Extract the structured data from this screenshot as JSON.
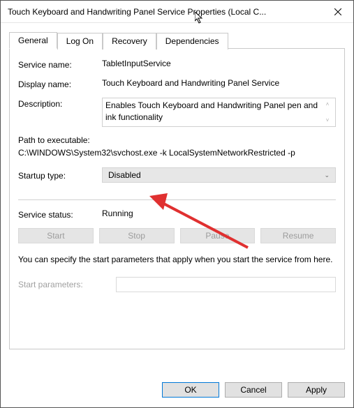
{
  "window": {
    "title": "Touch Keyboard and Handwriting Panel Service Properties (Local C..."
  },
  "tabs": {
    "general": "General",
    "log_on": "Log On",
    "recovery": "Recovery",
    "dependencies": "Dependencies"
  },
  "general": {
    "service_name_label": "Service name:",
    "service_name_value": "TabletInputService",
    "display_name_label": "Display name:",
    "display_name_value": "Touch Keyboard and Handwriting Panel Service",
    "description_label": "Description:",
    "description_value": "Enables Touch Keyboard and Handwriting Panel pen and ink functionality",
    "path_label": "Path to executable:",
    "path_value": "C:\\WINDOWS\\System32\\svchost.exe -k LocalSystemNetworkRestricted -p",
    "startup_label": "Startup type:",
    "startup_value": "Disabled",
    "status_label": "Service status:",
    "status_value": "Running",
    "btn_start": "Start",
    "btn_stop": "Stop",
    "btn_pause": "Pause",
    "btn_resume": "Resume",
    "help_text": "You can specify the start parameters that apply when you start the service from here.",
    "start_params_label": "Start parameters:",
    "start_params_value": ""
  },
  "footer": {
    "ok": "OK",
    "cancel": "Cancel",
    "apply": "Apply"
  }
}
